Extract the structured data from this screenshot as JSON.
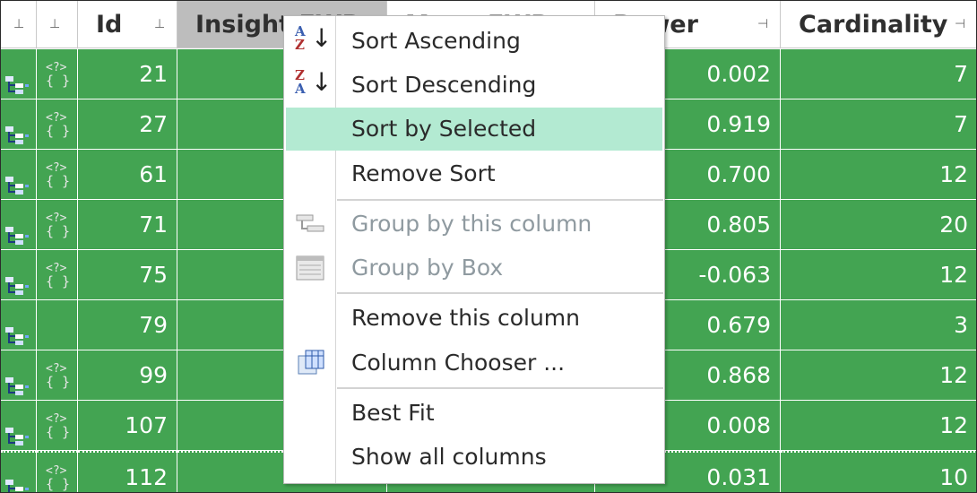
{
  "grid": {
    "columns": [
      {
        "id": "pin1",
        "label": "",
        "pin": "⊥"
      },
      {
        "id": "pin2",
        "label": "",
        "pin": "⊥"
      },
      {
        "id": "id",
        "label": "Id",
        "pin": "⊥"
      },
      {
        "id": "insight",
        "label": "Insight FWP",
        "pin": ""
      },
      {
        "id": "mean",
        "label": "Mean FWP",
        "pin": ""
      },
      {
        "id": "power",
        "label": "Power",
        "pin": "⊣"
      },
      {
        "id": "cardinality",
        "label": "Cardinality",
        "pin": "⊣"
      }
    ],
    "rows": [
      {
        "id": "21",
        "power": "0.002",
        "cardinality": "7",
        "has_json": true
      },
      {
        "id": "27",
        "power": "0.919",
        "cardinality": "7",
        "has_json": true
      },
      {
        "id": "61",
        "power": "0.700",
        "cardinality": "12",
        "has_json": true
      },
      {
        "id": "71",
        "power": "0.805",
        "cardinality": "20",
        "has_json": true
      },
      {
        "id": "75",
        "power": "-0.063",
        "cardinality": "12",
        "has_json": true
      },
      {
        "id": "79",
        "power": "0.679",
        "cardinality": "3",
        "has_json": false
      },
      {
        "id": "99",
        "power": "0.868",
        "cardinality": "12",
        "has_json": true
      },
      {
        "id": "107",
        "power": "0.008",
        "cardinality": "12",
        "has_json": true
      },
      {
        "id": "112",
        "power": "0.031",
        "cardinality": "10",
        "has_json": true
      }
    ],
    "row_color": "#43a452"
  },
  "context_menu": {
    "items": [
      {
        "label": "Sort Ascending",
        "icon": "sort-ascending-icon",
        "disabled": false,
        "hover": false
      },
      {
        "label": "Sort Descending",
        "icon": "sort-descending-icon",
        "disabled": false,
        "hover": false
      },
      {
        "label": "Sort by Selected",
        "icon": "",
        "disabled": false,
        "hover": true
      },
      {
        "label": "Remove Sort",
        "icon": "",
        "disabled": false,
        "hover": false
      },
      {
        "label": "Group by this column",
        "icon": "group-column-icon",
        "disabled": true,
        "hover": false
      },
      {
        "label": "Group by Box",
        "icon": "group-box-icon",
        "disabled": true,
        "hover": false
      },
      {
        "label": "Remove this column",
        "icon": "",
        "disabled": false,
        "hover": false
      },
      {
        "label": "Column Chooser ...",
        "icon": "column-chooser-icon",
        "disabled": false,
        "hover": false
      },
      {
        "label": "Best Fit",
        "icon": "",
        "disabled": false,
        "hover": false
      },
      {
        "label": "Show all columns",
        "icon": "",
        "disabled": false,
        "hover": false
      }
    ],
    "hover_color": "#b3ead2"
  }
}
